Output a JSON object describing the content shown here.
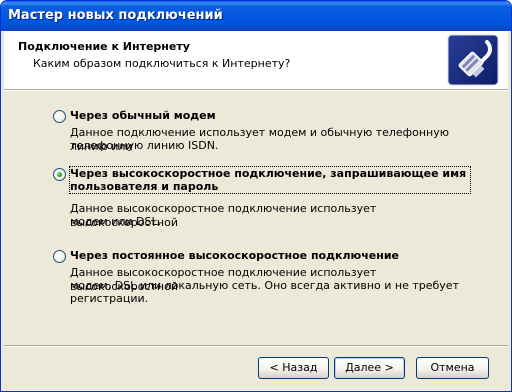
{
  "window": {
    "title": "Мастер новых подключений"
  },
  "header": {
    "title": "Подключение к Интернету",
    "subtitle": "Каким образом подключиться к Интернету?",
    "icon": "network-cable-icon"
  },
  "options": [
    {
      "label": "Через обычный модем",
      "desc1": "Данное подключение использует модем и обычную телефонную линию или",
      "desc2": "телефонную линию ISDN.",
      "desc3": "",
      "selected": false
    },
    {
      "label1": "Через высокоскоростное подключение, запрашивающее имя",
      "label2": "пользователя и пароль",
      "desc1": "Данное высокоскоростное подключение использует высокоскоростной",
      "desc2": "модем или DSL.",
      "desc3": "",
      "selected": true
    },
    {
      "label": "Через постоянное высокоскоростное подключение",
      "desc1": "Данное высокоскоростное подключение использует высокоскоростной",
      "desc2": "модем, DSL или локальную сеть. Оно всегда активно и не требует",
      "desc3": "регистрации.",
      "selected": false
    }
  ],
  "buttons": {
    "back": "< Назад",
    "next": "Далее >",
    "cancel": "Отмена"
  },
  "colors": {
    "titlebar": "#0054e3",
    "face": "#ece9d8",
    "radio_selected": "#21a121"
  }
}
